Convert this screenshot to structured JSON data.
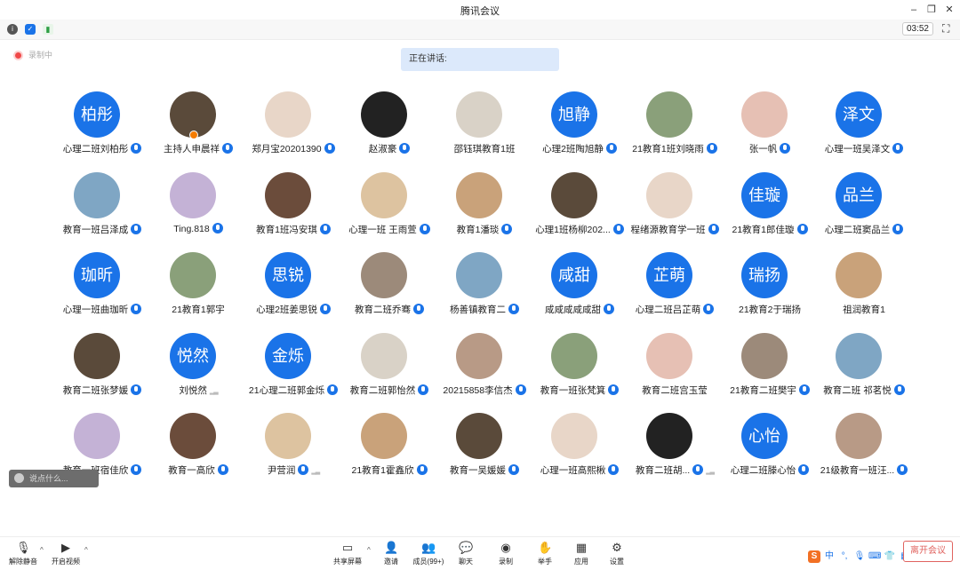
{
  "window": {
    "title": "腾讯会议",
    "timer": "03:52",
    "rec_label": "录制中",
    "speaking_label": "正在讲话:"
  },
  "participants": [
    {
      "name": "心理二班刘柏彤",
      "avatar_text": "柏彤",
      "mic": true
    },
    {
      "name": "主持人申晨祥",
      "avatar_text": "",
      "mic": true,
      "host": true
    },
    {
      "name": "郑月宝20201390",
      "avatar_text": "",
      "mic": true
    },
    {
      "name": "赵淑豪",
      "avatar_text": "",
      "mic": true
    },
    {
      "name": "邵钰琪教育1班",
      "avatar_text": "",
      "mic": false
    },
    {
      "name": "心理2班陶旭静",
      "avatar_text": "旭静",
      "mic": true
    },
    {
      "name": "21教育1班刘晓雨",
      "avatar_text": "",
      "mic": true
    },
    {
      "name": "张一帆",
      "avatar_text": "",
      "mic": true
    },
    {
      "name": "心理一班吴泽文",
      "avatar_text": "泽文",
      "mic": true
    },
    {
      "name": "教育一班吕泽成",
      "avatar_text": "",
      "mic": true
    },
    {
      "name": "Ting.818",
      "avatar_text": "",
      "mic": true
    },
    {
      "name": "教育1班冯安琪",
      "avatar_text": "",
      "mic": true
    },
    {
      "name": "心理一班  王雨萱",
      "avatar_text": "",
      "mic": true
    },
    {
      "name": "教育1潘琰",
      "avatar_text": "",
      "mic": true
    },
    {
      "name": "心理1班杨柳202...",
      "avatar_text": "",
      "mic": true
    },
    {
      "name": "程绪源教育学一班",
      "avatar_text": "",
      "mic": true
    },
    {
      "name": "21教育1郎佳璇",
      "avatar_text": "佳璇",
      "mic": true
    },
    {
      "name": "心理二班窦品兰",
      "avatar_text": "品兰",
      "mic": true
    },
    {
      "name": "心理一班曲珈昕",
      "avatar_text": "珈昕",
      "mic": true
    },
    {
      "name": "21教育1郭宇",
      "avatar_text": "",
      "mic": false
    },
    {
      "name": "心理2班姜思锐",
      "avatar_text": "思锐",
      "mic": true
    },
    {
      "name": "教育二班乔骞",
      "avatar_text": "",
      "mic": true
    },
    {
      "name": "杨善镇教育二",
      "avatar_text": "",
      "mic": true
    },
    {
      "name": "咸咸咸咸咸甜",
      "avatar_text": "咸甜",
      "mic": true
    },
    {
      "name": "心理二班吕芷萌",
      "avatar_text": "芷萌",
      "mic": true
    },
    {
      "name": "21教育2于瑞扬",
      "avatar_text": "瑞扬",
      "mic": false
    },
    {
      "name": "祖润教育1",
      "avatar_text": "",
      "mic": false
    },
    {
      "name": "教育二班张梦媛",
      "avatar_text": "",
      "mic": true
    },
    {
      "name": "刘悦然",
      "avatar_text": "悦然",
      "mic": false,
      "bars": true
    },
    {
      "name": "21心理二班郭金烁",
      "avatar_text": "金烁",
      "mic": true
    },
    {
      "name": "教育二班郭怡然",
      "avatar_text": "",
      "mic": true
    },
    {
      "name": "20215858李信杰",
      "avatar_text": "",
      "mic": true
    },
    {
      "name": "教育一班张梵箕",
      "avatar_text": "",
      "mic": true
    },
    {
      "name": "教育二班宫玉莹",
      "avatar_text": "",
      "mic": false
    },
    {
      "name": "21教育二班樊宇",
      "avatar_text": "",
      "mic": true
    },
    {
      "name": "教育二班 祁茗悦",
      "avatar_text": "",
      "mic": true
    },
    {
      "name": "教育一班宿佳欣",
      "avatar_text": "",
      "mic": true
    },
    {
      "name": "教育一高欣",
      "avatar_text": "",
      "mic": true
    },
    {
      "name": "尹营润",
      "avatar_text": "",
      "mic": true,
      "bars": true
    },
    {
      "name": "21教育1霍鑫欣",
      "avatar_text": "",
      "mic": true
    },
    {
      "name": "教育一吴媛媛",
      "avatar_text": "",
      "mic": true
    },
    {
      "name": "心理一班高熙楸",
      "avatar_text": "",
      "mic": true
    },
    {
      "name": "教育二班胡...",
      "avatar_text": "",
      "mic": true,
      "bars": true
    },
    {
      "name": "心理二班滕心怡",
      "avatar_text": "心怡",
      "mic": true
    },
    {
      "name": "21级教育一班汪...",
      "avatar_text": "",
      "mic": true
    }
  ],
  "say_placeholder": "说点什么...",
  "toolbar": {
    "mute": "解除静音",
    "video": "开启视频",
    "share": "共享屏幕",
    "invite": "邀请",
    "members": "成员(99+)",
    "chat": "聊天",
    "record": "录制",
    "raise": "举手",
    "apps": "应用",
    "settings": "设置",
    "leave": "离开会议"
  },
  "ime": {
    "s": "S",
    "mode": "中"
  },
  "colors": {
    "avatar_blue": "#1a73e8",
    "leave_red": "#e0635f",
    "speaking_bg": "#dce9fb"
  }
}
